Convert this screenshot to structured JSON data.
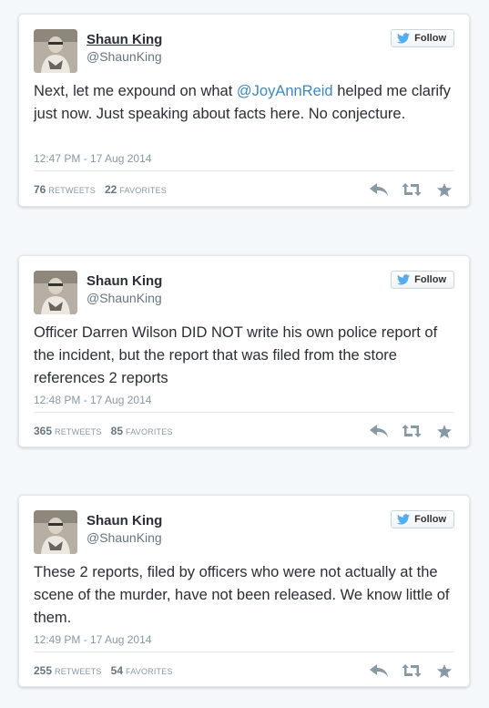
{
  "colors": {
    "link": "#3b88c3",
    "twitter_bird": "#55acee",
    "muted": "#8899a6",
    "background": "#f5f8fa"
  },
  "tweets": [
    {
      "author": "Shaun King",
      "handle": "@ShaunKing",
      "follow_label": "Follow",
      "text_before": "Next, let me expound on what ",
      "mention": "@JoyAnnReid",
      "text_after": " helped me clarify just now. Just speaking about facts here. No conjecture.",
      "timestamp": "12:47 PM - 17 Aug 2014",
      "retweets": "76",
      "retweets_label": "RETWEETS",
      "favorites": "22",
      "favorites_label": "FAVORITES"
    },
    {
      "author": "Shaun King",
      "handle": "@ShaunKing",
      "follow_label": "Follow",
      "text_before": "Officer Darren Wilson DID NOT write his own police report of the incident, but the report that was filed from the store references 2 reports",
      "mention": "",
      "text_after": "",
      "timestamp": "12:48 PM - 17 Aug 2014",
      "retweets": "365",
      "retweets_label": "RETWEETS",
      "favorites": "85",
      "favorites_label": "FAVORITES"
    },
    {
      "author": "Shaun King",
      "handle": "@ShaunKing",
      "follow_label": "Follow",
      "text_before": "These 2 reports, filed by officers who were not actually at the scene of the murder, have not been released. We know little of them.",
      "mention": "",
      "text_after": "",
      "timestamp": "12:49 PM - 17 Aug 2014",
      "retweets": "255",
      "retweets_label": "RETWEETS",
      "favorites": "54",
      "favorites_label": "FAVORITES"
    }
  ]
}
